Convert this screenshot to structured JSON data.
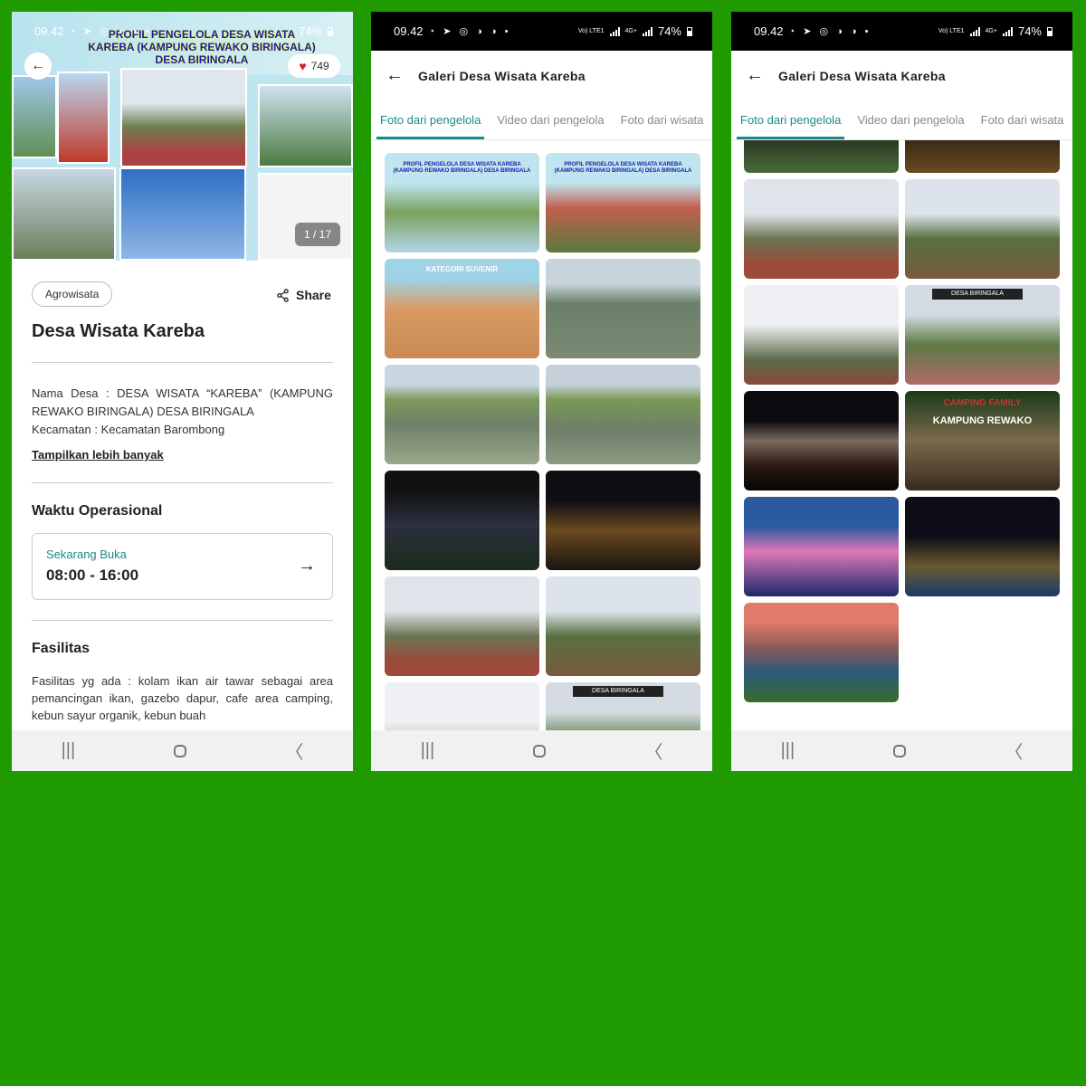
{
  "status_bar": {
    "time": "09.42",
    "app_icons": "◔ ➤ ◎ ◑ ◑ •",
    "network": "Vo) LTE1",
    "network2": "4G+",
    "battery": "74%"
  },
  "detail": {
    "hero_title_line1": "PROFIL PENGELOLA DESA WISATA",
    "hero_title_line2": "KAREBA (KAMPUNG REWAKO BIRINGALA)",
    "hero_title_line3": "DESA BIRINGALA",
    "like_count": "749",
    "image_counter": "1 / 17",
    "category_chip": "Agrowisata",
    "share_label": "Share",
    "title": "Desa Wisata Kareba",
    "nama_desa": "Nama Desa  : DESA WISATA “KAREBA” (KAMPUNG REWAKO BIRINGALA) DESA BIRINGALA",
    "kecamatan": "Kecamatan      : Kecamatan Barombong",
    "show_more": "Tampilkan lebih banyak",
    "hours_heading": "Waktu Operasional",
    "hours_status": "Sekarang Buka",
    "hours_value": "08:00 - 16:00",
    "facilities_heading": "Fasilitas",
    "facilities_text": "Fasilitas yg ada : kolam ikan air tawar sebagai area pemancingan ikan, gazebo dapur, cafe area camping, kebun sayur organik, kebun buah"
  },
  "gallery": {
    "title": "Galeri Desa Wisata Kareba",
    "tabs": [
      "Foto dari pengelola",
      "Video dari pengelola",
      "Foto dari wisata"
    ],
    "poster_profil": "PROFIL PENGELOLA DESA WISATA KAREBA (KAMPUNG REWAKO BIRINGALA) DESA BIRINGALA",
    "poster_suvenir": "KATEGORI SUVENIR",
    "sign_desa": "DESA BIRINGALA",
    "camping_title": "CAMPING FAMILY",
    "camping_sub": "KAMPUNG REWAKO"
  },
  "colors": {
    "background": "#1f9a00",
    "accent": "#1c8a8a",
    "like": "#d9202a"
  }
}
